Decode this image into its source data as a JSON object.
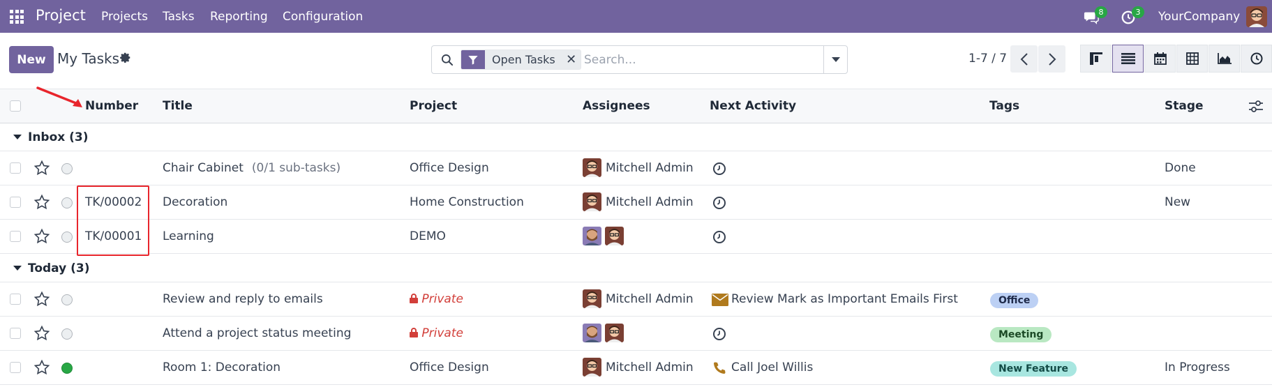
{
  "navbar": {
    "app_name": "Project",
    "menu": [
      "Projects",
      "Tasks",
      "Reporting",
      "Configuration"
    ],
    "messages_badge": "8",
    "activities_badge": "3",
    "company": "YourCompany",
    "bg_color": "#71639e"
  },
  "control": {
    "new_label": "New",
    "breadcrumb": "My Tasks",
    "facet_label": "Open Tasks",
    "search_placeholder": "Search...",
    "pager": "1-7 / 7"
  },
  "table": {
    "headers": {
      "number": "Number",
      "title": "Title",
      "project": "Project",
      "assignees": "Assignees",
      "next_activity": "Next Activity",
      "tags": "Tags",
      "stage": "Stage"
    },
    "groups": [
      {
        "label": "Inbox (3)",
        "rows": [
          {
            "number": "",
            "title": "Chair Cabinet",
            "subtasks": "(0/1 sub-tasks)",
            "project": "Office Design",
            "assignee": "Mitchell Admin",
            "activity": "",
            "tag": "",
            "stage": "Done"
          },
          {
            "number": "TK/00002",
            "title": "Decoration",
            "subtasks": "",
            "project": "Home Construction",
            "assignee": "Mitchell Admin",
            "activity": "",
            "tag": "",
            "stage": "New"
          },
          {
            "number": "TK/00001",
            "title": "Learning",
            "subtasks": "",
            "project": "DEMO",
            "assignee": "",
            "activity": "",
            "tag": "",
            "stage": ""
          }
        ]
      },
      {
        "label": "Today (3)",
        "rows": [
          {
            "number": "",
            "title": "Review and reply to emails",
            "subtasks": "",
            "project": "Private",
            "assignee": "Mitchell Admin",
            "activity": "Review Mark as Important Emails First",
            "tag": "Office",
            "stage": ""
          },
          {
            "number": "",
            "title": "Attend a project status meeting",
            "subtasks": "",
            "project": "Private",
            "assignee": "",
            "activity": "",
            "tag": "Meeting",
            "stage": ""
          },
          {
            "number": "",
            "title": "Room 1: Decoration",
            "subtasks": "",
            "project": "Office Design",
            "assignee": "Mitchell Admin",
            "activity": "Call Joel Willis",
            "tag": "New Feature",
            "stage": "In Progress"
          }
        ]
      }
    ],
    "tag_colors": {
      "Office": "#bcd0f4",
      "Meeting": "#b9e8c2",
      "New Feature": "#a8e6e0"
    }
  }
}
